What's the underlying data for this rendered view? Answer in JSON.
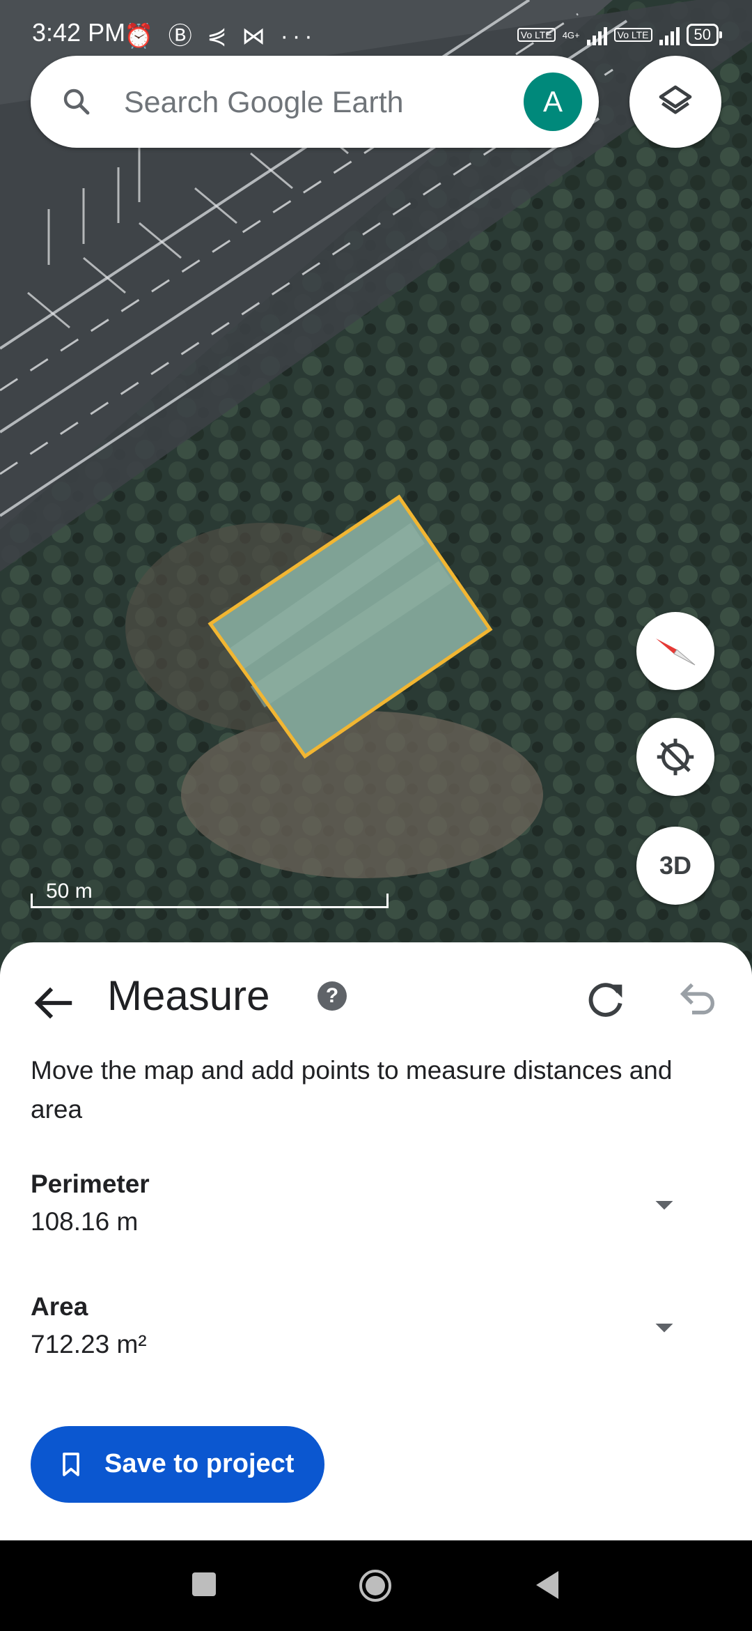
{
  "status_bar": {
    "time": "3:42 PM",
    "notification_icons": "⏰ Ⓑ ⋞ ⋈ ···",
    "network_tag_1": "Vo LTE",
    "network_small": "4G+",
    "network_tag_2": "Vo LTE",
    "battery": "50"
  },
  "search": {
    "placeholder": "Search Google Earth",
    "avatar_letter": "A"
  },
  "map": {
    "scale_label": "50 m",
    "polygon_color": "#f2b632",
    "compass_color": "#e53935"
  },
  "map_controls": {
    "three_d_label": "3D"
  },
  "measure": {
    "title": "Measure",
    "help_glyph": "?",
    "instructions": "Move the map and add points to measure distances and area",
    "perimeter_label": "Perimeter",
    "perimeter_value": "108.16 m",
    "area_label": "Area",
    "area_value": "712.23 m²",
    "save_label": "Save to project"
  },
  "icons": {
    "search": "search-icon",
    "layers": "layers-icon",
    "compass": "compass-icon",
    "location": "location-off-icon",
    "back": "arrow-back-icon",
    "help": "help-icon",
    "redo": "redo-icon",
    "undo": "undo-icon",
    "dropdown": "arrow-drop-down-icon",
    "bookmark": "bookmark-icon"
  },
  "colors": {
    "accent": "#0b57d0",
    "avatar": "#00897b"
  }
}
